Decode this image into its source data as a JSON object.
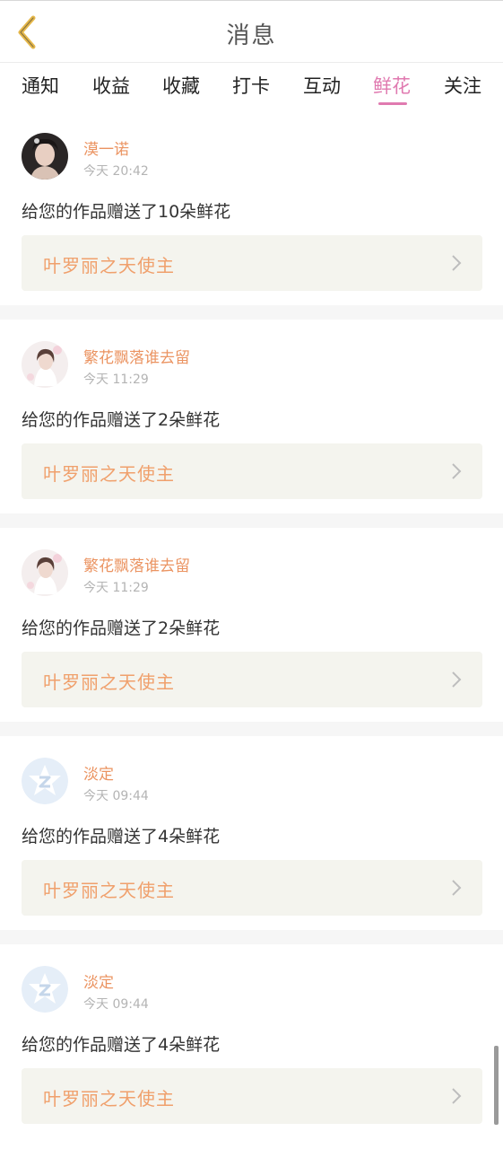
{
  "header": {
    "title": "消息",
    "back_icon": "chevron-left-icon",
    "back_icon_color": "#e6b84a"
  },
  "tabs": [
    {
      "label": "通知",
      "active": false
    },
    {
      "label": "收益",
      "active": false
    },
    {
      "label": "收藏",
      "active": false
    },
    {
      "label": "打卡",
      "active": false
    },
    {
      "label": "互动",
      "active": false
    },
    {
      "label": "鲜花",
      "active": true
    },
    {
      "label": "关注",
      "active": false
    }
  ],
  "colors": {
    "accent": "#e07ab0",
    "username": "#eb9462",
    "work_title": "#f0a06c",
    "link_bg": "#f4f4ee"
  },
  "messages": [
    {
      "user": "漠一诺",
      "time": "今天 20:42",
      "text": "给您的作品赠送了10朵鲜花",
      "work": "叶罗丽之天使主",
      "avatar": "photo-avatar-dark"
    },
    {
      "user": "繁花飘落谁去留",
      "time": "今天 11:29",
      "text": "给您的作品赠送了2朵鲜花",
      "work": "叶罗丽之天使主",
      "avatar": "photo-avatar-light"
    },
    {
      "user": "繁花飘落谁去留",
      "time": "今天 11:29",
      "text": "给您的作品赠送了2朵鲜花",
      "work": "叶罗丽之天使主",
      "avatar": "photo-avatar-light"
    },
    {
      "user": "淡定",
      "time": "今天 09:44",
      "text": "给您的作品赠送了4朵鲜花",
      "work": "叶罗丽之天使主",
      "avatar": "default-star-avatar"
    },
    {
      "user": "淡定",
      "time": "今天 09:44",
      "text": "给您的作品赠送了4朵鲜花",
      "work": "叶罗丽之天使主",
      "avatar": "default-star-avatar"
    }
  ]
}
